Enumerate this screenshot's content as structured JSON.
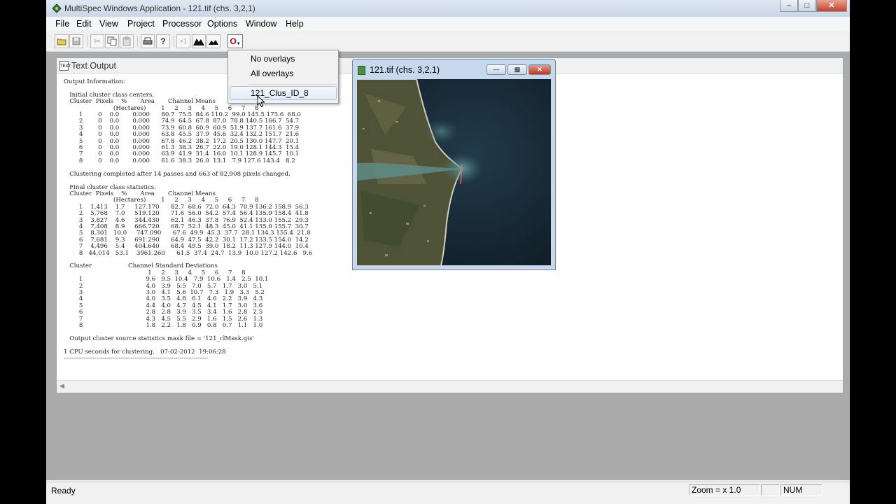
{
  "window": {
    "title": "MultiSpec Windows Application - 121.tif (chs. 3,2,1)",
    "minimize_icon": "minimize-icon",
    "maximize_icon": "maximize-icon",
    "close_icon": "close-icon"
  },
  "menu": {
    "items": [
      "File",
      "Edit",
      "View",
      "Project",
      "Processor",
      "Options",
      "Window",
      "Help"
    ]
  },
  "toolbar": {
    "overlay_button_label": "O"
  },
  "overlay_menu": {
    "items": [
      "No overlays",
      "All overlays",
      "121_Clus_ID_8"
    ]
  },
  "text_output": {
    "title": "Text Output",
    "content": "Output Information:\n\n   Initial cluster class centers.\n   Cluster  Pixels    %       Area       Channel Means\n                          (Hectares)        1     2     3     4     5     6     7     8\n        1        0    0.0       0.000      80.7  75.5  84.6 110.2  99.0 145.5 175.6  68.0\n        2        0    0.0       0.000      74.9  64.5  67.8  87.0  78.8 140.5 166.7  54.7\n        3        0    0.0       0.000      73.9  60.8  60.9  60.9  51.9 137.7 161.6  37.9\n        4        0    0.0       0.000      63.8  45.5  37.9  45.6  32.4 132.2 151.7  21.6\n        5        0    0.0       0.000      67.8  46.2  38.2  17.2  20.5 130.0 147.7  20.1\n        6        0    0.0       0.000      61.3  38.3  26.7  22.0  19.0 128.1 144.3  15.4\n        7        0    0.0       0.000      63.9  41.9  31.4  16.0  10.1 128.9 145.7  10.1\n        8        0    0.0       0.000      61.6  38.3  26.0  13.1   7.9 127.6 143.4   8.2\n\n   Clustering completed after 14 passes and 663 of 82,908 pixels changed.\n\n   Final cluster class statistics.\n   Cluster  Pixels    %       Area       Channel Means\n                          (Hectares)        1     2     3     4     5     6     7     8\n        1    1,413    1.7     127.170      82.7  68.6  72.0  64.3  70.9 136.2 158.9  56.3\n        2    5,768    7.0     519.120      71.6  56.0  54.2  57.4  56.4 135.9 158.4  41.8\n        3    3,827    4.6     344.430      62.1  46.3  37.8  76.9  52.4 133.0 155.2  29.3\n        4    7,408    8.9     666.720      68.7  52.1  48.3  45.0  41.1 135.0 155.7  30.7\n        5    8,301   10.0     747.090      67.6  49.9  45.3  37.7  28.1 134.3 155.4  21.8\n        6    7,681    9.3     691.290      64.9  47.5  42.2  30.1  17.2 133.5 154.0  14.2\n        7    4,496    5.4     404.640      68.4  49.5  39.0  18.2  11.3 127.9 144.0  10.4\n        8   44,014   53.1    3961.260      61.5  37.4  24.7  13.9  10.0 127.2 142.6   9.6\n\n   Cluster                   Channel Standard Deviations\n                                            1     2     3     4     5     6     7     8\n        1                                 9.6   9.5  10.4   7.9  10.6   1.4   2.5  10.1\n        2                                 4.0   3.9   5.5   7.0   5.7   1.7   3.0   5.1\n        3                                 3.0   4.1   5.6  10.7   7.3   1.9   3.3   5.2\n        4                                 4.0   3.5   4.8   6.1   4.6   2.2   3.9   4.3\n        5                                 4.4   4.0   4.7   4.5   4.1   1.7   3.0   3.6\n        6                                 2.8   2.8   3.9   3.5   3.4   1.6   2.8   2.5\n        7                                 4.3   4.5   5.5   2.9   1.6   1.5   2.6   1.3\n        8                                 1.8   2.2   1.8   0.9   0.8   0.7   1.1   1.0\n\n   Output cluster source statistics mask file = '121_clMask.gis'\n\n1 CPU seconds for clustering.   07-02-2012  19:06:28\n-----------------------------------------------------------------------"
  },
  "image_window": {
    "title": "121.tif (chs. 3,2,1)"
  },
  "status": {
    "ready": "Ready",
    "zoom": "Zoom = x 1.0",
    "num": "NUM"
  }
}
